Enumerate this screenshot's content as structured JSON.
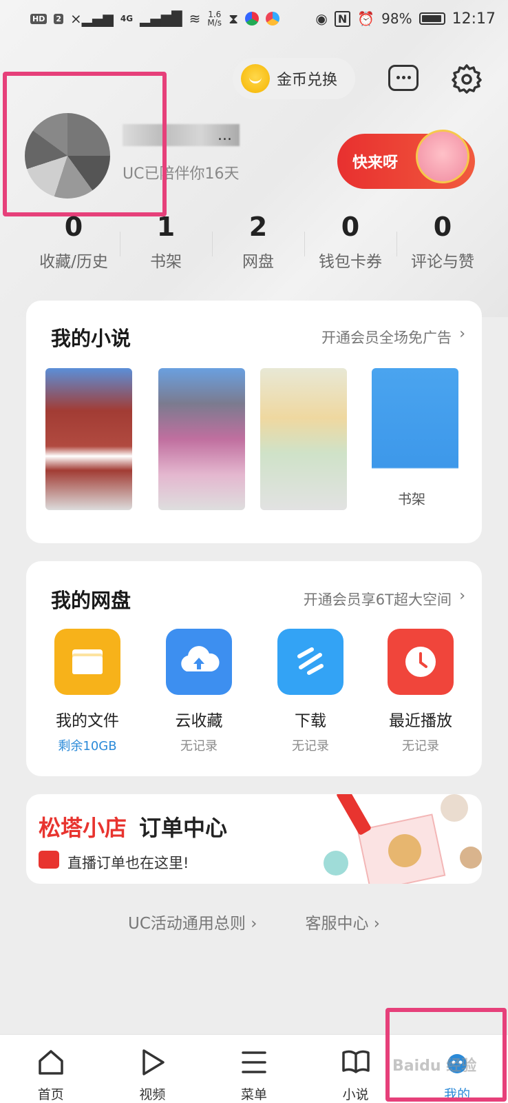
{
  "status_bar": {
    "hd_label": "HD",
    "sim_label": "2",
    "network_label": "4G",
    "speed_value": "1.6",
    "speed_unit": "M/s",
    "battery_percent": "98%",
    "time": "12:17"
  },
  "header": {
    "coin_exchange_label": "金币兑换",
    "message_icon": "message-icon",
    "settings_icon": "gear-icon"
  },
  "profile": {
    "username_suffix": "...",
    "days_text": "UC已陪伴你16天",
    "promo_label": "快来呀"
  },
  "stats": [
    {
      "value": "0",
      "label": "收藏/历史"
    },
    {
      "value": "1",
      "label": "书架"
    },
    {
      "value": "2",
      "label": "网盘"
    },
    {
      "value": "0",
      "label": "钱包卡券"
    },
    {
      "value": "0",
      "label": "评论与赞"
    }
  ],
  "novels": {
    "title": "我的小说",
    "link": "开通会员全场免广告",
    "shelf_label": "书架"
  },
  "drive": {
    "title": "我的网盘",
    "link": "开通会员享6T超大空间",
    "items": [
      {
        "name": "我的文件",
        "sub": "剩余10GB",
        "icon": "folder-icon",
        "color": "#f7b21a"
      },
      {
        "name": "云收藏",
        "sub": "无记录",
        "icon": "cloud-upload-icon",
        "color": "#3d8ff0"
      },
      {
        "name": "下载",
        "sub": "无记录",
        "icon": "download-icon",
        "color": "#33a3f5"
      },
      {
        "name": "最近播放",
        "sub": "无记录",
        "icon": "clock-icon",
        "color": "#f0453b"
      }
    ]
  },
  "shop_banner": {
    "title_red": "松塔小店",
    "title_black": "订单中心",
    "subtitle": "直播订单也在这里!"
  },
  "footer_links": {
    "rules": "UC活动通用总则 ›",
    "service": "客服中心 ›"
  },
  "bottom_nav": [
    {
      "label": "首页",
      "icon": "home-icon"
    },
    {
      "label": "视频",
      "icon": "play-icon"
    },
    {
      "label": "菜单",
      "icon": "menu-icon"
    },
    {
      "label": "小说",
      "icon": "book-icon"
    },
    {
      "label": "我的",
      "icon": "profile-icon"
    }
  ],
  "watermark": "Baidu 经验",
  "colors": {
    "accent": "#2b8ad8",
    "highlight": "#e6407a",
    "shop_red": "#e8342f"
  }
}
